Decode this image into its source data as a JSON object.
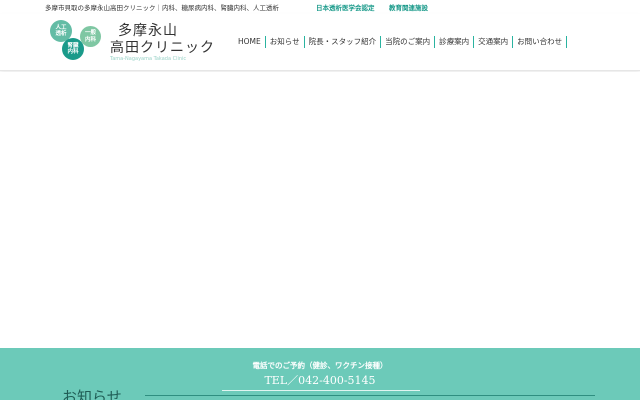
{
  "topbar": {
    "description": "多摩市貝取の多摩永山高田クリニック｜内科、糖尿病内科、腎臓内科、人工透析",
    "badge1": "日本透析医学会認定",
    "badge2": "教育関連施設"
  },
  "logo": {
    "circle1": "人工\n透析",
    "circle2": "一般\n内科",
    "circle3": "腎臓\n内科",
    "name_line1": "多摩永山",
    "name_line2": "高田クリニック",
    "roman": "Tama-Nagayama Takada Clinic"
  },
  "nav": {
    "items": [
      "HOME",
      "お知らせ",
      "院長・スタッフ紹介",
      "当院のご案内",
      "診療案内",
      "交通案内",
      "お問い合わせ"
    ]
  },
  "footer": {
    "tel_note": "電話でのご予約（健診、ワクチン接種）",
    "tel_number": "TEL／042-400-5145"
  },
  "news": {
    "title": "お知らせ"
  },
  "colors": {
    "accent": "#1a9a8a",
    "band": "#6ccab9"
  }
}
